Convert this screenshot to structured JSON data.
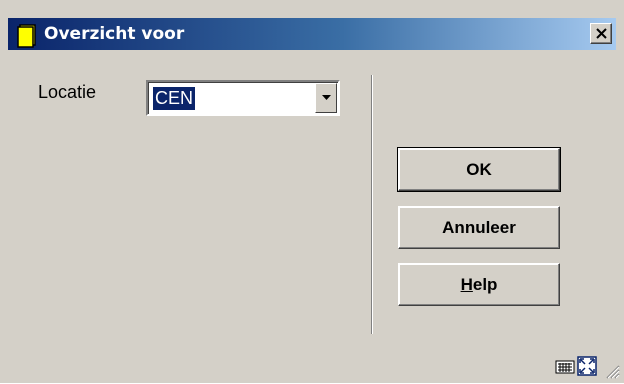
{
  "window": {
    "title": "Overzicht voor",
    "title_icon": "document-yellow-icon",
    "close_icon": "close-icon"
  },
  "form": {
    "locatie_label": "Locatie",
    "locatie_value": "CEN"
  },
  "buttons": {
    "ok_label": "OK",
    "cancel_label": "Annuleer",
    "help_accel": "H",
    "help_rest": "elp"
  },
  "status_bar": {
    "icons": [
      "keyboard-icon",
      "fullscreen-icon",
      "resize-grip-icon"
    ]
  },
  "colors": {
    "title_bar_start": "#0a246a",
    "title_bar_end": "#a6caf0",
    "dialog_bg": "#d4d0c8",
    "selection": "#0a246a"
  }
}
